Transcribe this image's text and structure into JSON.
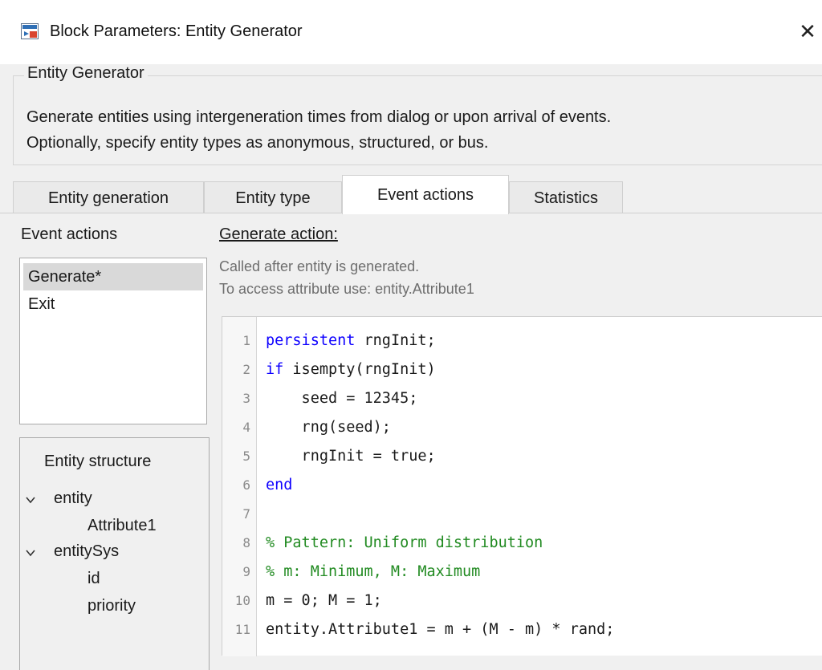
{
  "window": {
    "title": "Block Parameters: Entity Generator",
    "close_glyph": "✕"
  },
  "group": {
    "legend": "Entity Generator",
    "description_line1": "Generate entities using intergeneration times from dialog or upon arrival of events.",
    "description_line2": "Optionally, specify entity types as anonymous, structured, or bus."
  },
  "tabs": [
    {
      "label": "Entity generation",
      "active": false
    },
    {
      "label": "Entity type",
      "active": false
    },
    {
      "label": "Event actions",
      "active": true
    },
    {
      "label": "Statistics",
      "active": false
    }
  ],
  "event_actions": {
    "label": "Event actions",
    "items": [
      {
        "label": "Generate*",
        "selected": true
      },
      {
        "label": "Exit",
        "selected": false
      }
    ]
  },
  "entity_structure": {
    "title": "Entity structure",
    "tree": {
      "entity": "entity",
      "attribute1": "Attribute1",
      "entitySys": "entitySys",
      "id": "id",
      "priority": "priority"
    }
  },
  "generate_action": {
    "label": "Generate action:",
    "hint_line1": "Called after entity is generated.",
    "hint_line2": "To access attribute use: entity.Attribute1"
  },
  "code": {
    "lines": [
      {
        "n": "1",
        "kw": "persistent",
        "rest": " rngInit;",
        "comment": ""
      },
      {
        "n": "2",
        "kw": "if",
        "rest": " isempty(rngInit)",
        "comment": ""
      },
      {
        "n": "3",
        "kw": "",
        "rest": "    seed = 12345;",
        "comment": ""
      },
      {
        "n": "4",
        "kw": "",
        "rest": "    rng(seed);",
        "comment": ""
      },
      {
        "n": "5",
        "kw": "",
        "rest": "    rngInit = true;",
        "comment": ""
      },
      {
        "n": "6",
        "kw": "end",
        "rest": "",
        "comment": ""
      },
      {
        "n": "7",
        "kw": "",
        "rest": "",
        "comment": ""
      },
      {
        "n": "8",
        "kw": "",
        "rest": "",
        "comment": "% Pattern: Uniform distribution"
      },
      {
        "n": "9",
        "kw": "",
        "rest": "",
        "comment": "% m: Minimum, M: Maximum"
      },
      {
        "n": "10",
        "kw": "",
        "rest": "m = 0; M = 1;",
        "comment": ""
      },
      {
        "n": "11",
        "kw": "",
        "rest": "entity.Attribute1 = m + (M - m) * rand;",
        "comment": ""
      }
    ]
  },
  "colors": {
    "keyword": "#0e00ff",
    "comment": "#228b22",
    "selected_item": "#d9d9d9"
  }
}
